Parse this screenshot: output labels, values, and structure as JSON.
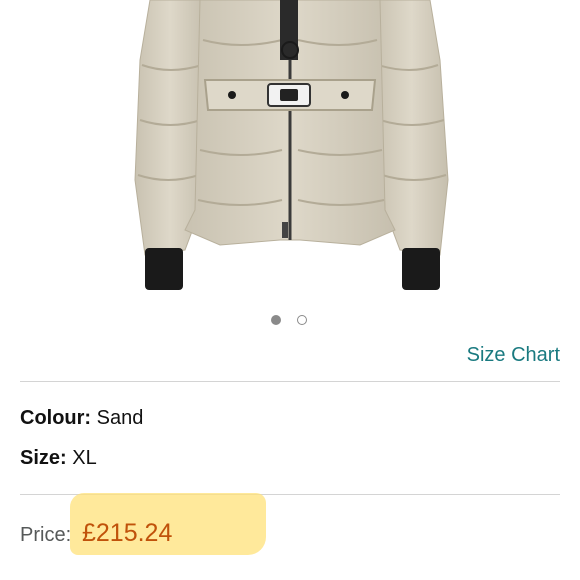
{
  "product": {
    "image_alt": "Sand quilted belted puffer jacket",
    "carousel": {
      "total": 2,
      "active_index": 1
    }
  },
  "links": {
    "size_chart": "Size Chart"
  },
  "details": {
    "colour_label": "Colour:",
    "colour_value": "Sand",
    "size_label": "Size:",
    "size_value": "XL"
  },
  "price": {
    "label": "Price:",
    "value": "£215.24",
    "highlight_color": "#ffe27a",
    "price_color": "#c0520a"
  },
  "colors": {
    "link": "#1a7a80",
    "jacket": "#d9d3c3",
    "cuffs": "#1a1a1a"
  }
}
